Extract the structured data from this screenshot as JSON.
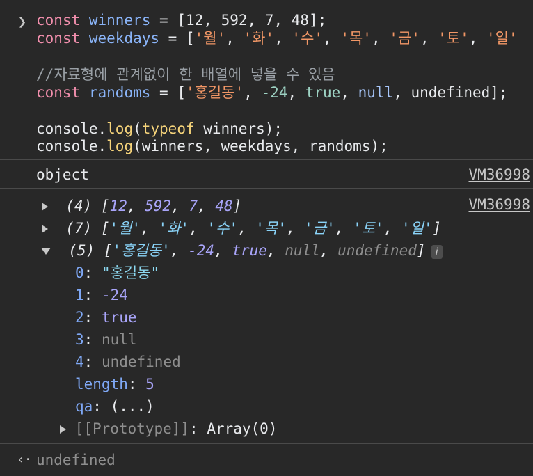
{
  "input": {
    "line1": {
      "kw": "const",
      "name": "winners",
      "eq": " = [",
      "n1": "12",
      "n2": "592",
      "n3": "7",
      "n4": "48",
      "end": "];"
    },
    "line2": {
      "kw": "const",
      "name": "weekdays",
      "eq": " = [",
      "items": [
        "'월'",
        "'화'",
        "'수'",
        "'목'",
        "'금'",
        "'토'",
        "'일'"
      ]
    },
    "comment": "//자료형에 관계없이 한 배열에 넣을 수 있음",
    "line4": {
      "kw": "const",
      "name": "randoms",
      "eq": " = [",
      "s1": "'홍길동'",
      "n1": "-24",
      "b1": "true",
      "nl": "null",
      "ud": "undefined",
      "end": "];"
    },
    "line5": {
      "obj": "console.",
      "fn": "log",
      "open": "(",
      "op": "typeof",
      "arg": " winners",
      "close": ");"
    },
    "line6": {
      "obj": "console.",
      "fn": "log",
      "args": "(winners, weekdays, randoms);"
    }
  },
  "output": {
    "log1": {
      "text": "object",
      "source": "VM36998"
    },
    "log2": {
      "source": "VM36998",
      "arr1": {
        "count": "(4)",
        "values": [
          "12",
          "592",
          "7",
          "48"
        ]
      },
      "arr2": {
        "count": "(7)",
        "values": [
          "'월'",
          "'화'",
          "'수'",
          "'목'",
          "'금'",
          "'토'",
          "'일'"
        ]
      },
      "arr3": {
        "count": "(5)",
        "s1": "'홍길동'",
        "n1": "-24",
        "b1": "true",
        "nl": "null",
        "ud": "undefined",
        "badge": "i",
        "entries": [
          {
            "key": "0",
            "value": "\"홍길동\""
          },
          {
            "key": "1",
            "value": "-24"
          },
          {
            "key": "2",
            "value": "true"
          },
          {
            "key": "3",
            "value": "null"
          },
          {
            "key": "4",
            "value": "undefined"
          }
        ],
        "length_key": "length",
        "length_val": "5",
        "qa_key": "qa",
        "qa_val": "(...)",
        "proto_key": "[[Prototype]]",
        "proto_val": "Array(0)"
      }
    },
    "result": "undefined"
  },
  "icons": {
    "prompt": "chevron-right-icon",
    "result": "chevron-left-icon",
    "expand": "caret-right-icon",
    "collapse": "caret-down-icon",
    "info": "info-icon"
  },
  "colors": {
    "background": "#282828",
    "keyword": "#f28fad",
    "identifier": "#8ab4f8",
    "string": "#f29766",
    "function": "#f5d37a"
  }
}
